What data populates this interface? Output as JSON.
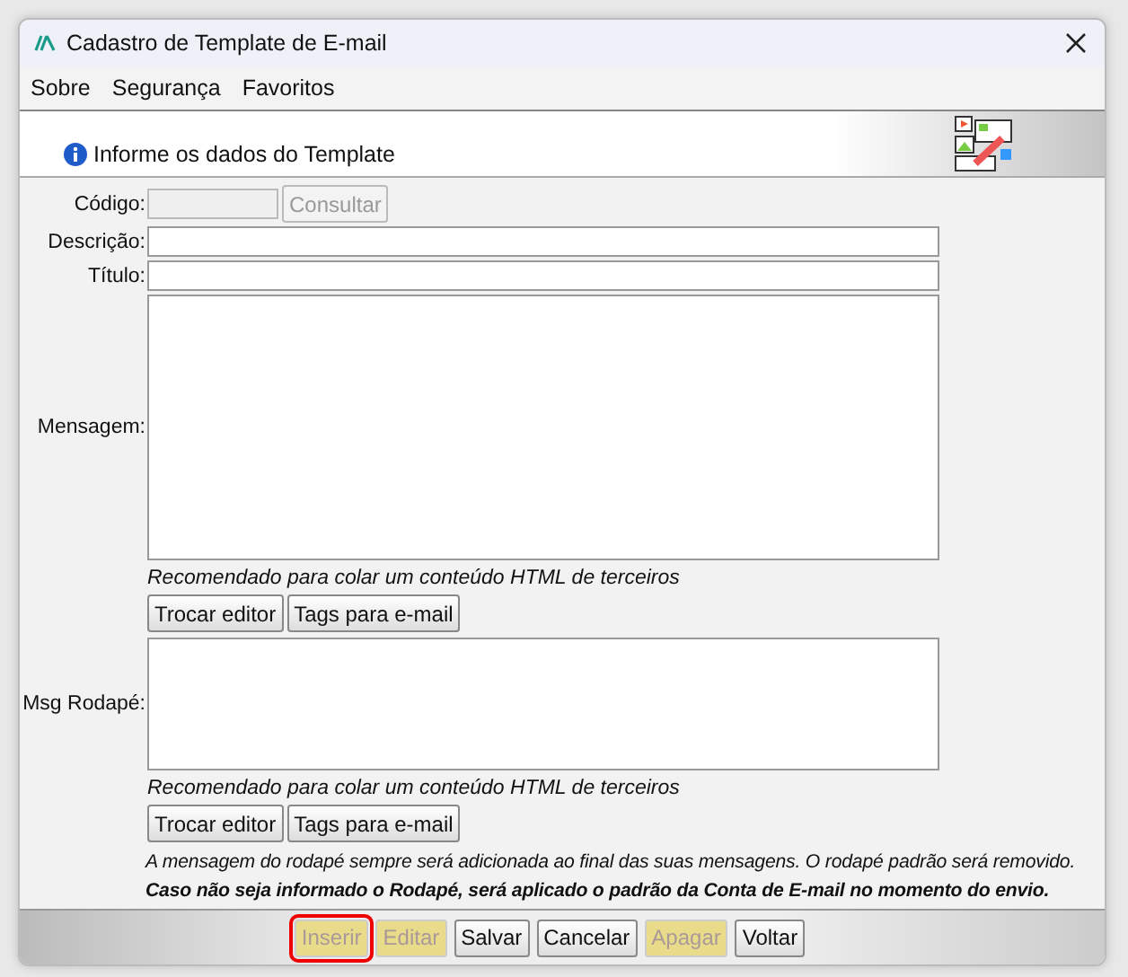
{
  "window": {
    "title": "Cadastro de Template de E-mail"
  },
  "menu": [
    "Sobre",
    "Segurança",
    "Favoritos"
  ],
  "header": {
    "text": "Informe os dados do Template"
  },
  "codigo": {
    "label": "Código:",
    "disabled": true,
    "button": {
      "label": "Consultar",
      "disabled": true
    }
  },
  "descricao": {
    "label": "Descrição:"
  },
  "titulo": {
    "label": "Título:"
  },
  "mensagem": {
    "label": "Mensagem:",
    "hint": "Recomendado para colar um conteúdo HTML de terceiros",
    "buttons": [
      "Trocar editor",
      "Tags para e-mail"
    ]
  },
  "rodape": {
    "label": "Msg Rodapé:",
    "hint": "Recomendado para colar um conteúdo HTML de terceiros",
    "buttons": [
      "Trocar editor",
      "Tags para e-mail"
    ]
  },
  "notes": [
    "A mensagem do rodapé sempre será adicionada ao final das suas mensagens. O rodapé padrão será removido.",
    "Caso não seja informado o Rodapé, será aplicado o padrão da Conta de E-mail no momento do envio."
  ],
  "actions": [
    {
      "label": "Inserir",
      "disabled": true,
      "focused": true
    },
    {
      "label": "Editar",
      "disabled": true,
      "focused": false
    },
    {
      "label": "Salvar",
      "disabled": false,
      "focused": false
    },
    {
      "label": "Cancelar",
      "disabled": false,
      "focused": false
    },
    {
      "label": "Apagar",
      "disabled": true,
      "focused": false
    },
    {
      "label": "Voltar",
      "disabled": false,
      "focused": false
    }
  ]
}
